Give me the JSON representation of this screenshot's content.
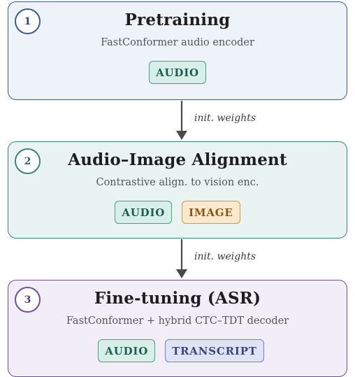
{
  "stages": [
    {
      "number": "1",
      "title": "Pretraining",
      "subtitle": "FastConformer audio encoder",
      "tags": [
        "AUDIO"
      ]
    },
    {
      "number": "2",
      "title": "Audio–Image Alignment",
      "subtitle": "Contrastive align. to vision enc.",
      "tags": [
        "AUDIO",
        "IMAGE"
      ]
    },
    {
      "number": "3",
      "title": "Fine-tuning (ASR)",
      "subtitle": "FastConformer + hybrid CTC–TDT decoder",
      "tags": [
        "AUDIO",
        "TRANSCRIPT"
      ]
    }
  ],
  "connectors": [
    {
      "label": "init. weights"
    },
    {
      "label": "init. weights"
    }
  ],
  "colors": {
    "stage1_border": "#3c5d8f",
    "stage2_border": "#3b8477",
    "stage3_border": "#6e4f99",
    "audio_tag": "#d8efe9",
    "image_tag": "#fbe9cd",
    "transcript_tag": "#dfe3f3",
    "arrow": "#4a4a4a"
  }
}
